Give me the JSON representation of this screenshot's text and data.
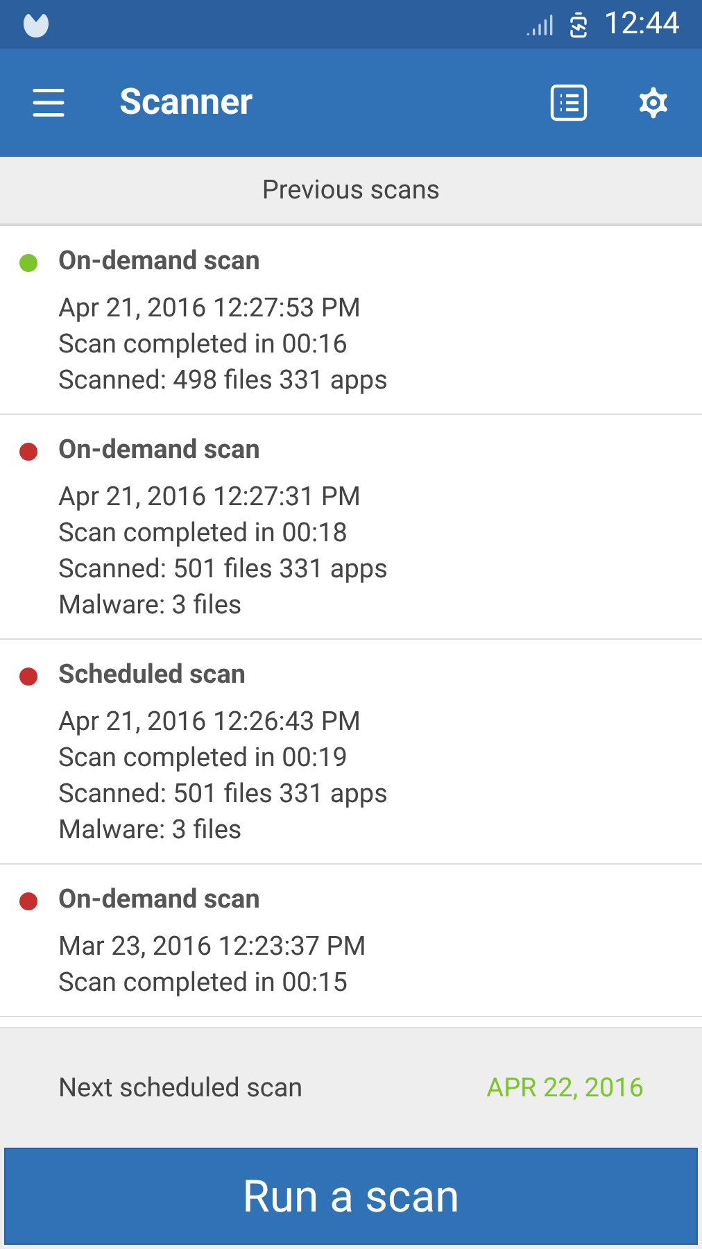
{
  "status_bar": {
    "time": "12:44"
  },
  "app_bar": {
    "title": "Scanner"
  },
  "section_header": "Previous scans",
  "scans": [
    {
      "title": "On-demand scan",
      "color": "#7cc42a",
      "lines": [
        "Apr 21, 2016 12:27:53 PM",
        "Scan completed in 00:16",
        "Scanned: 498 files 331 apps"
      ]
    },
    {
      "title": "On-demand scan",
      "color": "#c62f2f",
      "lines": [
        "Apr 21, 2016 12:27:31 PM",
        "Scan completed in 00:18",
        "Scanned: 501 files 331 apps",
        "Malware: 3 files"
      ]
    },
    {
      "title": "Scheduled scan",
      "color": "#c62f2f",
      "lines": [
        "Apr 21, 2016 12:26:43 PM",
        "Scan completed in 00:19",
        "Scanned: 501 files 331 apps",
        "Malware: 3 files"
      ]
    },
    {
      "title": "On-demand scan",
      "color": "#c62f2f",
      "lines": [
        "Mar 23, 2016 12:23:37 PM",
        "Scan completed in 00:15"
      ]
    }
  ],
  "next_scan": {
    "label": "Next scheduled scan",
    "value": "APR 22, 2016"
  },
  "run_button": "Run a scan"
}
